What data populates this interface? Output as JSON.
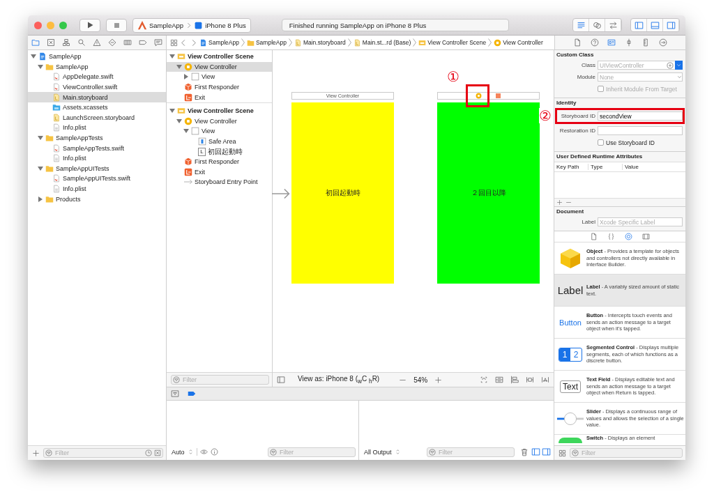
{
  "toolbar": {
    "scheme": "SampleApp",
    "device": "iPhone 8 Plus",
    "status": "Finished running SampleApp on iPhone 8 Plus",
    "editor_modes": [
      {
        "kind": "lines",
        "selected": true
      },
      {
        "kind": "rings",
        "selected": false
      },
      {
        "kind": "swap",
        "selected": false
      }
    ],
    "panels": [
      {
        "kind": "panelleft",
        "selected": true
      },
      {
        "kind": "panelbottom",
        "selected": true
      },
      {
        "kind": "panelright",
        "selected": true
      }
    ]
  },
  "navigator_tabs": [
    {
      "kind": "navfolder",
      "selected": true
    },
    {
      "kind": "xsquare",
      "selected": false
    },
    {
      "kind": "hierarchy",
      "selected": false
    },
    {
      "kind": "search",
      "selected": false
    },
    {
      "kind": "warning",
      "selected": false
    },
    {
      "kind": "diamond",
      "selected": false
    },
    {
      "kind": "tests",
      "selected": false
    },
    {
      "kind": "tag",
      "selected": false
    },
    {
      "kind": "message",
      "selected": false
    }
  ],
  "jump_bar": [
    {
      "kind": "project",
      "label": "SampleApp"
    },
    {
      "kind": "folder",
      "label": "SampleApp"
    },
    {
      "kind": "storyboard",
      "label": "Main.storyboard"
    },
    {
      "kind": "storyboard",
      "label": "Main.st...rd (Base)"
    },
    {
      "kind": "scene",
      "label": "View Controller Scene"
    },
    {
      "kind": "vc",
      "label": "View Controller"
    }
  ],
  "inspector_tabs": [
    {
      "kind": "file",
      "selected": false
    },
    {
      "kind": "help",
      "selected": false
    },
    {
      "kind": "identity",
      "selected": true
    },
    {
      "kind": "attributes",
      "selected": false
    },
    {
      "kind": "size",
      "selected": false
    },
    {
      "kind": "connections",
      "selected": false
    }
  ],
  "navigator": {
    "tree": [
      {
        "kind": "project",
        "name": "SampleApp",
        "expanded": true,
        "selected": false,
        "children": [
          {
            "kind": "folder",
            "name": "SampleApp",
            "expanded": true,
            "selected": false,
            "children": [
              {
                "kind": "swift",
                "name": "AppDelegate.swift",
                "selected": false
              },
              {
                "kind": "swift",
                "name": "ViewController.swift",
                "selected": false
              },
              {
                "kind": "storyboard",
                "name": "Main.storyboard",
                "selected": true
              },
              {
                "kind": "assets",
                "name": "Assets.xcassets",
                "selected": false
              },
              {
                "kind": "storyboard",
                "name": "LaunchScreen.storyboard",
                "selected": false
              },
              {
                "kind": "plist",
                "name": "Info.plist",
                "selected": false
              }
            ]
          },
          {
            "kind": "folder",
            "name": "SampleAppTests",
            "expanded": true,
            "selected": false,
            "children": [
              {
                "kind": "swift",
                "name": "SampleAppTests.swift",
                "selected": false
              },
              {
                "kind": "plist",
                "name": "Info.plist",
                "selected": false
              }
            ]
          },
          {
            "kind": "folder",
            "name": "SampleAppUITests",
            "expanded": true,
            "selected": false,
            "children": [
              {
                "kind": "swift",
                "name": "SampleAppUITests.swift",
                "selected": false
              },
              {
                "kind": "plist",
                "name": "Info.plist",
                "selected": false
              }
            ]
          },
          {
            "kind": "folder",
            "name": "Products",
            "expanded": false,
            "selected": false
          }
        ]
      }
    ],
    "filter": {
      "placeholder": "Filter"
    }
  },
  "outline": {
    "tree": [
      {
        "kind": "scene",
        "name": "View Controller Scene",
        "expanded": true,
        "selected": false,
        "children": [
          {
            "kind": "vc",
            "name": "View Controller",
            "expanded": true,
            "selected": true,
            "children": [
              {
                "kind": "view",
                "name": "View",
                "expanded": false,
                "selected": false
              }
            ]
          },
          {
            "kind": "responder",
            "name": "First Responder",
            "selected": false
          },
          {
            "kind": "exit",
            "name": "Exit",
            "selected": false
          }
        ]
      },
      {
        "kind": "scene",
        "name": "View Controller Scene",
        "expanded": true,
        "selected": false,
        "children": [
          {
            "kind": "vc",
            "name": "View Controller",
            "expanded": true,
            "selected": false,
            "children": [
              {
                "kind": "view",
                "name": "View",
                "expanded": true,
                "selected": false,
                "children": [
                  {
                    "kind": "safearea",
                    "name": "Safe Area",
                    "selected": false
                  },
                  {
                    "kind": "label",
                    "badge": "L",
                    "name": "初回起動時",
                    "selected": false
                  }
                ]
              }
            ]
          },
          {
            "kind": "responder",
            "name": "First Responder",
            "selected": false
          },
          {
            "kind": "exit",
            "name": "Exit",
            "selected": false
          },
          {
            "kind": "entry",
            "name": "Storyboard Entry Point",
            "selected": false
          }
        ]
      }
    ],
    "filter": {
      "placeholder": "Filter"
    }
  },
  "canvas": {
    "scenes": [
      {
        "title": "View Controller",
        "label": "初回起動時",
        "color": "#ffff00",
        "entry_point": true
      },
      {
        "label": "２回目以降",
        "color": "#00ff00",
        "entry_point": false,
        "marker": "①"
      }
    ],
    "view_as": "View as: iPhone 8 ($_{w}$C $_{h}$R)",
    "zoom": "54%"
  },
  "debug": {
    "variables_mode": "Auto",
    "variables_filter": {
      "placeholder": "Filter"
    },
    "console_mode": "All Output",
    "console_filter": {
      "placeholder": "Filter"
    }
  },
  "inspector": {
    "custom_class": {
      "title": "Custom Class",
      "class_label": "Class",
      "class_placeholder": "UIViewController",
      "module_label": "Module",
      "module_placeholder": "None",
      "inherit_label": "Inherit Module From Target",
      "inherit_checked": false
    },
    "identity": {
      "title": "Identity",
      "storyboard_id_label": "Storyboard ID",
      "storyboard_id": "secondView",
      "marker": "②",
      "restoration_id_label": "Restoration ID",
      "use_storyboard_id_label": "Use Storyboard ID",
      "use_storyboard_id_checked": false
    },
    "runtime_attributes": {
      "title": "User Defined Runtime Attributes",
      "columns": [
        "Key Path",
        "Type",
        "Value"
      ]
    },
    "document": {
      "title": "Document",
      "label_label": "Label",
      "label_placeholder": "Xcode Specific Label"
    }
  },
  "library": {
    "tabs": [
      {
        "kind": "file",
        "selected": false
      },
      {
        "kind": "braces",
        "selected": false
      },
      {
        "kind": "target",
        "selected": true
      },
      {
        "kind": "media",
        "selected": false
      }
    ],
    "items": [
      {
        "kind": "object",
        "title": "Object",
        "description": " - Provides a template for objects and controllers not directly available in Interface Builder.",
        "selected": false
      },
      {
        "kind": "label",
        "preview": "Label",
        "title": "Label",
        "description": " - A variably sized amount of static text.",
        "selected": true
      },
      {
        "kind": "button",
        "preview": "Button",
        "title": "Button",
        "description": " - Intercepts touch events and sends an action message to a target object when it's tapped.",
        "selected": false
      },
      {
        "kind": "segmented",
        "segments": [
          "1",
          "2"
        ],
        "title": "Segmented Control",
        "description": " - Displays multiple segments, each of which functions as a discrete button.",
        "selected": false
      },
      {
        "kind": "textfield",
        "preview": "Text",
        "title": "Text Field",
        "description": " - Displays editable text and sends an action message to a target object when Return is tapped.",
        "selected": false
      },
      {
        "kind": "slider",
        "title": "Slider",
        "description": " - Displays a continuous range of values and allows the selection of a single value.",
        "selected": false
      },
      {
        "kind": "switch",
        "title": "Switch",
        "description": " - Displays an element",
        "selected": false
      }
    ],
    "filter": {
      "placeholder": "Filter"
    }
  }
}
